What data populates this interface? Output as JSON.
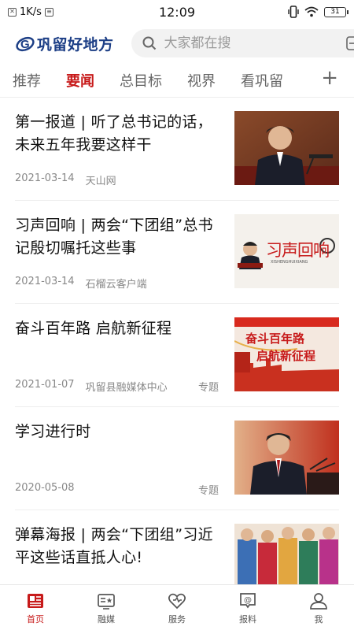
{
  "status_bar": {
    "net_speed": "1K/s",
    "time": "12:09",
    "battery": "31"
  },
  "header": {
    "logo_text": "巩留好地方",
    "search_placeholder": "大家都在搜"
  },
  "tabs": [
    {
      "label": "推荐",
      "active": false
    },
    {
      "label": "要闻",
      "active": true
    },
    {
      "label": "总目标",
      "active": false
    },
    {
      "label": "视界",
      "active": false
    },
    {
      "label": "看巩留",
      "active": false
    }
  ],
  "tab_add": "+",
  "news": [
    {
      "title": "第一报道 | 听了总书记的话，未来五年我要这样干",
      "date": "2021-03-14",
      "source": "天山网",
      "tag": ""
    },
    {
      "title": "习声回响 | 两会“下团组”总书记殷切嘱托这些事",
      "date": "2021-03-14",
      "source": "石榴云客户端",
      "tag": ""
    },
    {
      "title": "奋斗百年路 启航新征程",
      "date": "2021-01-07",
      "source": "巩留县融媒体中心",
      "tag": "专题"
    },
    {
      "title": "学习进行时",
      "date": "2020-05-08",
      "source": "",
      "tag": "专题"
    },
    {
      "title": "弹幕海报 | 两会“下团组”习近平这些话直抵人心!",
      "date": "",
      "source": "",
      "tag": ""
    }
  ],
  "thumbs": {
    "t2_logo": "习声回响",
    "t2_sub": "XISHENGHUIXIANG",
    "t3_line1": "奋斗百年路",
    "t3_line2": "启航新征程"
  },
  "bottom_nav": [
    {
      "label": "首页",
      "icon": "newspaper-icon",
      "active": true
    },
    {
      "label": "融媒",
      "icon": "media-card-icon",
      "active": false
    },
    {
      "label": "服务",
      "icon": "heart-icon",
      "active": false
    },
    {
      "label": "报料",
      "icon": "at-chat-icon",
      "active": false
    },
    {
      "label": "我",
      "icon": "user-icon",
      "active": false
    }
  ],
  "colors": {
    "accent": "#c71a1a",
    "logo": "#1d3f86"
  }
}
